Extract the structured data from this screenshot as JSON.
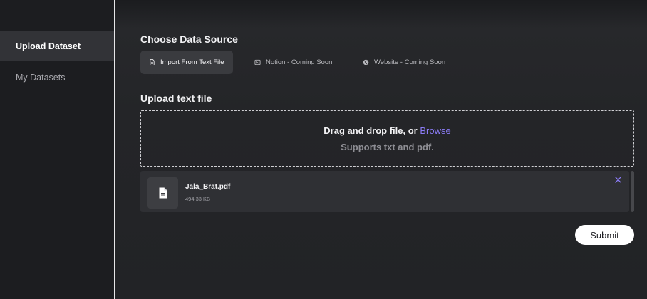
{
  "sidebar": {
    "items": [
      {
        "label": "Upload Dataset",
        "active": true
      },
      {
        "label": "My Datasets",
        "active": false
      }
    ]
  },
  "data_source": {
    "title": "Choose Data Source",
    "tabs": [
      {
        "label": "Import From Text File",
        "icon": "file-text-icon",
        "active": true
      },
      {
        "label": "Notion - Coming Soon",
        "icon": "notion-icon",
        "active": false
      },
      {
        "label": "Website - Coming Soon",
        "icon": "globe-icon",
        "active": false
      }
    ]
  },
  "upload": {
    "title": "Upload text file",
    "drop_prefix": "Drag and drop file, or ",
    "browse_label": "Browse",
    "supports_text": "Supports txt and pdf."
  },
  "file": {
    "name": "Jala_Brat.pdf",
    "size": "494.33 KB",
    "icon": "file-icon",
    "remove_icon": "close-icon"
  },
  "actions": {
    "submit_label": "Submit"
  },
  "colors": {
    "accent": "#8b7cf6",
    "background": "#202124",
    "sidebar": "#1c1d20"
  }
}
